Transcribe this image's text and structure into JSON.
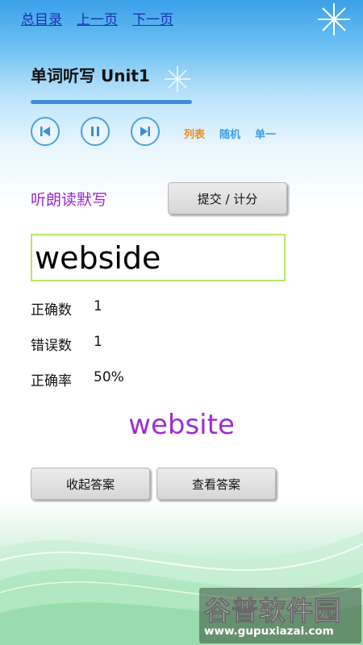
{
  "nav": {
    "home": "总目录",
    "prev": "上一页",
    "next": "下一页"
  },
  "title": "单词听写 Unit1",
  "progress": 1.0,
  "player": {
    "prev_icon": "skip-previous-icon",
    "pause_icon": "pause-icon",
    "next_icon": "skip-next-icon",
    "modes": {
      "list": "列表",
      "random": "随机",
      "single": "单一"
    },
    "mode_colors": {
      "list": "#f08a1f",
      "random": "#3aa0e0",
      "single": "#3aa0e0"
    }
  },
  "dictation": {
    "label": "听朗读默写",
    "submit_label": "提交 / 计分",
    "input_value": "webside"
  },
  "stats": {
    "correct_label": "正确数",
    "correct_value": "1",
    "wrong_label": "错误数",
    "wrong_value": "1",
    "rate_label": "正确率",
    "rate_value": "50%"
  },
  "answer": {
    "word": "website",
    "hide_label": "收起答案",
    "show_label": "查看答案"
  },
  "watermark": {
    "name": "谷普软件园",
    "url": "www.gupuxiazai.com"
  },
  "colors": {
    "accent": "#3b8ed6",
    "purple": "#9a29c9",
    "input_border": "#b5e86a"
  }
}
